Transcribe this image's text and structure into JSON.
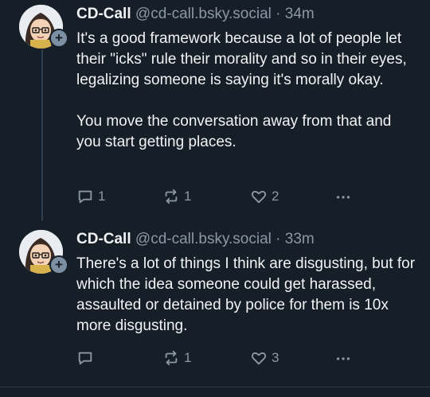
{
  "posts": [
    {
      "display_name": "CD-Call",
      "handle": "@cd-call.bsky.social",
      "separator": "·",
      "time": "34m",
      "paragraphs": [
        "It's a good framework because a lot of people let their \"icks\" rule their morality and so in their eyes, legalizing someone is saying it's morally okay.",
        "You move the conversation away from that and you start getting places."
      ],
      "reply_count": "1",
      "repost_count": "1",
      "like_count": "2"
    },
    {
      "display_name": "CD-Call",
      "handle": "@cd-call.bsky.social",
      "separator": "·",
      "time": "33m",
      "paragraphs": [
        "There's a lot of things I think are disgusting, but for which the idea someone could get harassed, assaulted or detained by police for them is 10x more disgusting."
      ],
      "reply_count": "",
      "repost_count": "1",
      "like_count": "3"
    }
  ],
  "follow_badge": "+",
  "colors": {
    "background": "#161e27",
    "text": "#f1f3f5",
    "muted": "#8b98a5",
    "thread_line": "#2e4052"
  },
  "icons": {
    "reply": "speech-bubble-icon",
    "repost": "repost-arrows-icon",
    "like": "heart-icon",
    "more": "ellipsis-icon"
  }
}
